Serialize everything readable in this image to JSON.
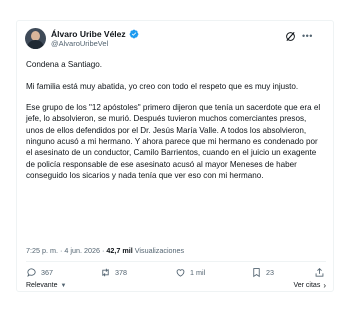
{
  "author": {
    "name": "Álvaro Uribe Vélez",
    "handle": "@AlvaroUribeVel",
    "verified_color": "#1d9bf0"
  },
  "post": {
    "paragraphs": [
      "Condena a Santiago.",
      "Mi familia está muy abatida, yo creo con todo el respeto que es muy injusto.",
      "Ese grupo de los \"12 apóstoles\" primero dijeron que tenía un sacerdote que era el jefe, lo absolvieron, se murió. Después tuvieron muchos comerciantes presos, unos de ellos defendidos por el Dr. Jesús María Valle. A todos los absolvieron, ninguno acusó a mi hermano. Y ahora parece que mi hermano es condenado por el asesinato de un conductor, Camilo Barrientos, cuando en el juicio un exagente de policía responsable de ese asesinato acusó al mayor Meneses de haber conseguido los sicarios y nada tenía que ver eso con mi hermano."
    ],
    "time": "7:25 p. m.",
    "separator": "·",
    "date": "4 jun. 2026",
    "views_count": "42,7 mil",
    "views_label": "Visualizaciones"
  },
  "actions": {
    "replies": "367",
    "reposts": "378",
    "likes": "1 mil",
    "bookmarks": "23"
  },
  "footer": {
    "sort_label": "Relevante",
    "quotes_label": "Ver citas"
  },
  "icons": [
    "verified-badge-icon",
    "grok-icon",
    "more-icon",
    "reply-icon",
    "retweet-icon",
    "like-icon",
    "bookmark-icon",
    "share-icon",
    "chevron-down-icon",
    "arrow-right-icon"
  ]
}
